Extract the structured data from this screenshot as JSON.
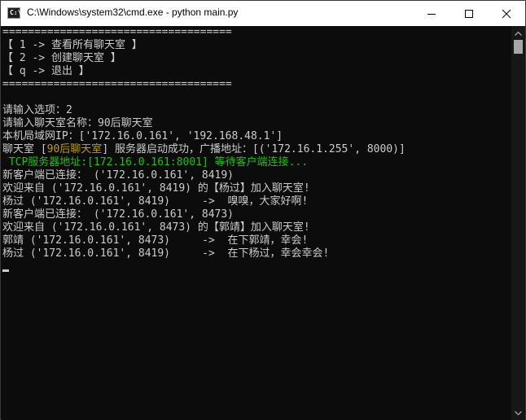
{
  "window": {
    "title": "C:\\Windows\\system32\\cmd.exe - python  main.py",
    "icon_text": "C:\\"
  },
  "console": {
    "lines": [
      "====================================",
      "【 1 -> 查看所有聊天室 】",
      "【 2 -> 创建聊天室 】",
      "【 q -> 退出 】",
      "====================================",
      "",
      "请输入选项：2",
      "请输入聊天室名称：90后聊天室",
      "本机局域网IP：['172.16.0.161', '192.168.48.1']",
      "聊天室 [90后聊天室] 服务器启动成功，广播地址：[('172.16.1.255', 8000)]",
      " TCP服务器地址:[172.16.0.161:8001] 等待客户端连接...",
      "新客户端已连接： ('172.16.0.161', 8419)",
      "欢迎来自 ('172.16.0.161', 8419) 的【杨过】加入聊天室!",
      "杨过 ('172.16.0.161', 8419)     ->  嗅嗅，大家好啊!",
      "新客户端已连接： ('172.16.0.161', 8473)",
      "欢迎来自 ('172.16.0.161', 8473) 的【郭靖】加入聊天室!",
      "郭靖 ('172.16.0.161', 8473)     ->  在下郭靖，幸会!",
      "杨过 ('172.16.0.161', 8419)     ->  在下杨过，幸会幸会!"
    ],
    "line9_parts": [
      "聊天室 [",
      "90后聊天室",
      "] 服务器启动成功，广播地址：[('172.16.1.255', 8000)]"
    ]
  },
  "colors": {
    "background": "#0c0c0c",
    "foreground": "#cccccc",
    "green": "#16c60c",
    "orange": "#c19c00"
  },
  "icons": [
    "cmd-icon",
    "minimize-icon",
    "maximize-icon",
    "close-icon",
    "scroll-up-icon",
    "scroll-down-icon"
  ]
}
